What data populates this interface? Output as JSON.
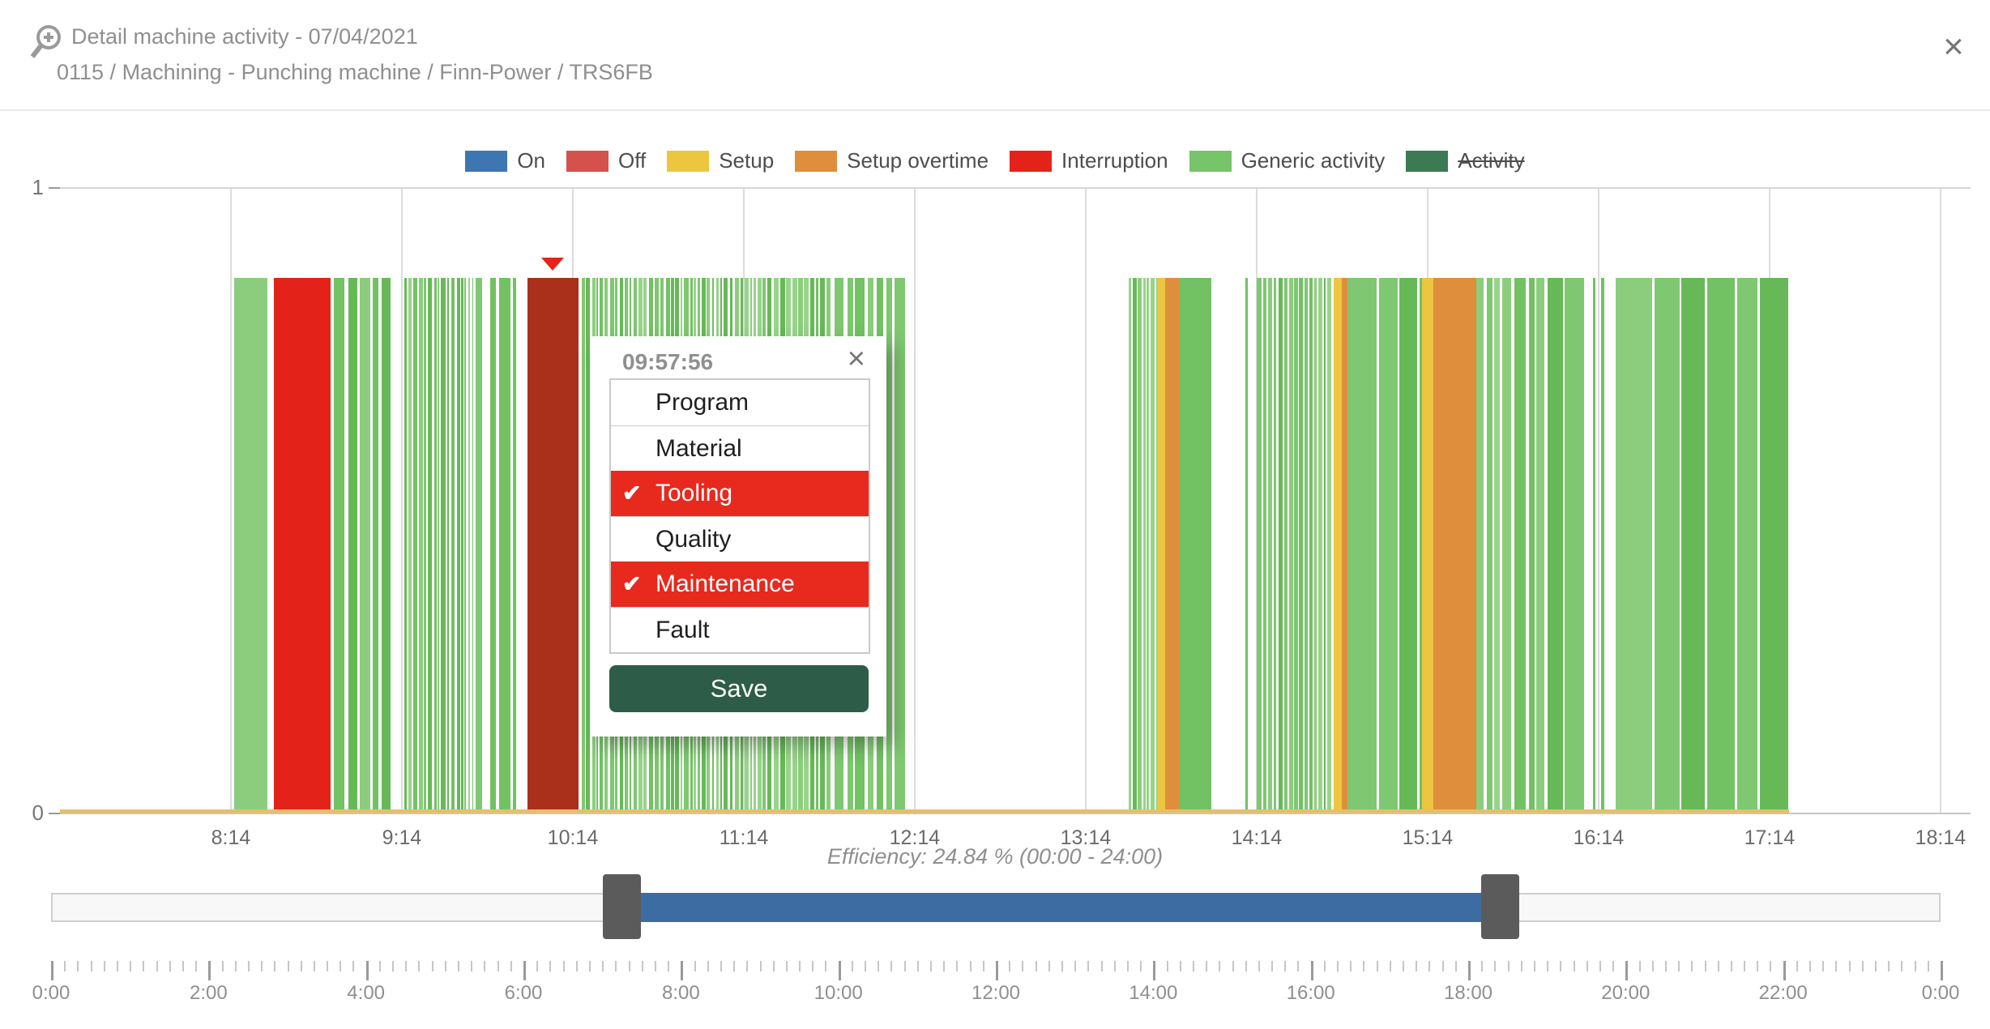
{
  "window": {
    "title": "Detail machine activity - 07/04/2021",
    "subtitle": "0115 / Machining - Punching machine / Finn-Power / TRS6FB",
    "close_glyph": "×"
  },
  "legend": [
    {
      "label": "On",
      "color": "#3d76b1",
      "struck": false
    },
    {
      "label": "Off",
      "color": "#d4514e",
      "struck": false
    },
    {
      "label": "Setup",
      "color": "#ecc63f",
      "struck": false
    },
    {
      "label": "Setup overtime",
      "color": "#df8e3c",
      "struck": false
    },
    {
      "label": "Interruption",
      "color": "#e3231a",
      "struck": false
    },
    {
      "label": "Generic activity",
      "color": "#77c46a",
      "struck": false
    },
    {
      "label": "Activity",
      "color": "#3c7a52",
      "struck": true
    }
  ],
  "chart_data": {
    "type": "timeline-bar",
    "title": "Machine activity timeline",
    "x_domain": [
      "7:14",
      "18:24"
    ],
    "x_tick_labels": [
      "8:14",
      "9:14",
      "10:14",
      "11:14",
      "12:14",
      "13:14",
      "14:14",
      "15:14",
      "16:14",
      "17:14",
      "18:14"
    ],
    "y_ticks": [
      "1",
      "0"
    ],
    "ylim": [
      0,
      1
    ],
    "bar_value": 0.855,
    "grid": true,
    "palette": {
      "generic": "#72c163",
      "generic_shades": [
        "#67b958",
        "#72c163",
        "#7fc771",
        "#8ccd7d",
        "#98d48a"
      ],
      "interruption": "#e3231a",
      "interruption_selected": "#aa301c",
      "setup": "#ecc63f",
      "setup_overtime": "#df8e3c",
      "baseline": "#e8bf62"
    },
    "baseline_strip": {
      "type": "setup",
      "from": "7:14",
      "to": "17:21"
    },
    "marker": {
      "time": "10:07",
      "shape": "triangle-down",
      "color": "#e3231a"
    },
    "segments": [
      {
        "from": "8:15",
        "to": "8:27",
        "type": "generic",
        "texture": "seams"
      },
      {
        "from": "8:29",
        "to": "8:49",
        "type": "interruption",
        "texture": "solid"
      },
      {
        "from": "8:50",
        "to": "9:10",
        "type": "generic",
        "texture": "striped-wide"
      },
      {
        "from": "9:15",
        "to": "9:39",
        "type": "generic",
        "texture": "striped"
      },
      {
        "from": "9:40",
        "to": "9:43",
        "type": "generic",
        "texture": "striped-wide"
      },
      {
        "from": "9:45",
        "to": "9:47",
        "type": "generic",
        "texture": "solid"
      },
      {
        "from": "9:48",
        "to": "9:52",
        "type": "generic",
        "texture": "seams"
      },
      {
        "from": "9:53",
        "to": "9:54",
        "type": "generic",
        "texture": "solid"
      },
      {
        "from": "9:58",
        "to": "10:16",
        "type": "interruption",
        "selected": true,
        "texture": "solid"
      },
      {
        "from": "10:17",
        "to": "11:45",
        "type": "generic",
        "texture": "striped"
      },
      {
        "from": "11:46",
        "to": "12:11",
        "type": "generic",
        "texture": "striped-wide"
      },
      {
        "from": "13:29",
        "to": "13:39",
        "type": "generic",
        "texture": "striped"
      },
      {
        "from": "13:39",
        "to": "13:42",
        "type": "setup",
        "texture": "solid"
      },
      {
        "from": "13:42",
        "to": "13:47",
        "type": "setup_overtime",
        "texture": "solid"
      },
      {
        "from": "13:47",
        "to": "13:58",
        "type": "generic",
        "texture": "solid"
      },
      {
        "from": "14:10",
        "to": "14:11",
        "type": "generic",
        "texture": "solid"
      },
      {
        "from": "14:14",
        "to": "14:41",
        "type": "generic",
        "texture": "striped"
      },
      {
        "from": "14:41",
        "to": "14:44",
        "type": "setup",
        "texture": "solid"
      },
      {
        "from": "14:44",
        "to": "14:46",
        "type": "setup_overtime",
        "texture": "solid"
      },
      {
        "from": "14:46",
        "to": "15:12",
        "type": "generic",
        "texture": "seams"
      },
      {
        "from": "15:12",
        "to": "15:16",
        "type": "setup",
        "texture": "solid"
      },
      {
        "from": "15:16",
        "to": "15:31",
        "type": "setup_overtime",
        "texture": "solid"
      },
      {
        "from": "15:31",
        "to": "15:55",
        "type": "generic",
        "texture": "striped-wide"
      },
      {
        "from": "15:56",
        "to": "16:09",
        "type": "generic",
        "texture": "seams"
      },
      {
        "from": "16:12",
        "to": "16:13",
        "type": "generic",
        "texture": "solid"
      },
      {
        "from": "16:15",
        "to": "16:16",
        "type": "generic",
        "texture": "solid"
      },
      {
        "from": "16:20",
        "to": "17:21",
        "type": "generic",
        "texture": "seams"
      }
    ],
    "efficiency_note": "Efficiency: 24.84 % (00:00 - 24:00)"
  },
  "popup": {
    "time": "09:57:56",
    "close_glyph": "×",
    "check_glyph": "✔",
    "highlight_color": "#e8291e",
    "save_color": "#2d5d48",
    "save_label": "Save",
    "options": [
      {
        "label": "Program",
        "checked": false
      },
      {
        "label": "Material",
        "checked": false
      },
      {
        "label": "Tooling",
        "checked": true
      },
      {
        "label": "Quality",
        "checked": false
      },
      {
        "label": "Maintenance",
        "checked": true
      },
      {
        "label": "Fault",
        "checked": false
      }
    ]
  },
  "slider": {
    "from": "7:15",
    "to": "18:24",
    "fill_color": "#3d6ca2",
    "handle_color": "#5b5b5b",
    "track_domain": [
      "0:00",
      "24:00"
    ]
  },
  "bottom_axis": {
    "minor_step_minutes": 10,
    "major_step_minutes": 120,
    "labels": [
      "0:00",
      "2:00",
      "4:00",
      "6:00",
      "8:00",
      "10:00",
      "12:00",
      "14:00",
      "16:00",
      "18:00",
      "20:00",
      "22:00",
      "0:00"
    ]
  }
}
